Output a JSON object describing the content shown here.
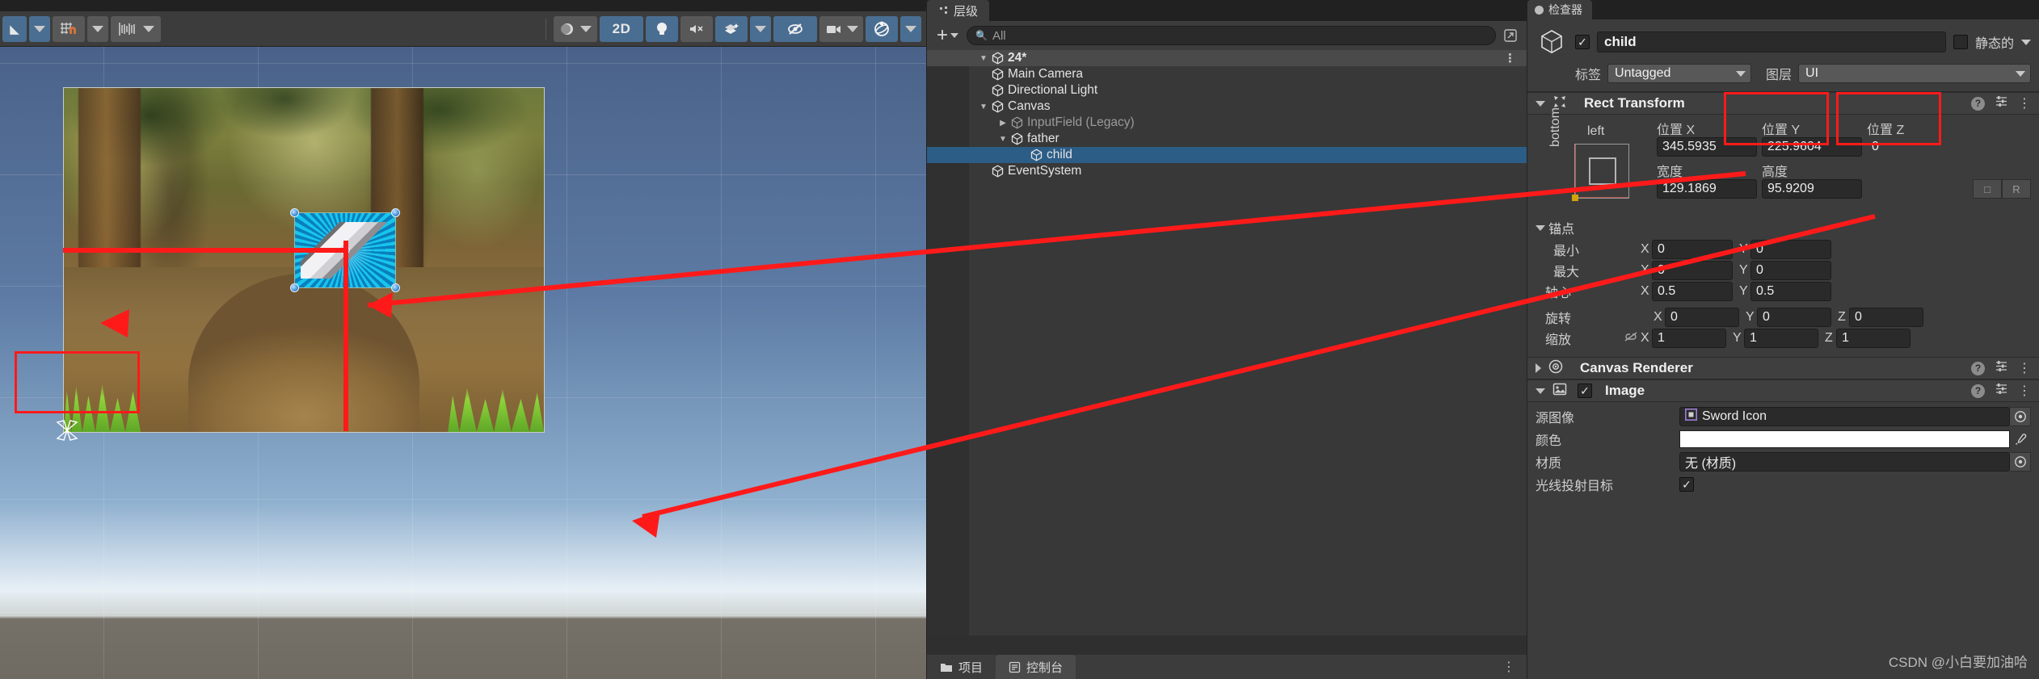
{
  "scene": {
    "toolbar": {
      "items": [
        {
          "name": "tool-handles-caret",
          "icon": "chevron-down-icon",
          "style": "blue"
        },
        {
          "name": "grid-snap-toggle",
          "icon": "grid-magnet-icon",
          "style": "gray"
        },
        {
          "name": "grid-snap-caret",
          "icon": "chevron-down-icon",
          "style": "gray"
        },
        {
          "name": "grid-visibility",
          "icon": "grid-lines-icon",
          "style": "gray"
        },
        {
          "name": "grid-visibility-caret",
          "icon": "chevron-down-icon",
          "style": "gray"
        }
      ],
      "draw_mode_label": "",
      "two_d_label": "2D",
      "lighting_icon": "lightbulb-icon",
      "audio_icon": "audio-mute-icon",
      "fx_icon": "effects-icon",
      "hidden_icon": "eye-slash-icon",
      "camera_icon": "camera-icon",
      "gizmos_icon": "gizmos-globe-icon"
    },
    "selection": {
      "object_name": "child",
      "sprite": "Sword Icon"
    }
  },
  "hierarchy": {
    "tab_label": "层级",
    "add_label": "+",
    "search_placeholder": "All",
    "search_value": "",
    "scene_name": "24*",
    "items": [
      {
        "label": "Main Camera",
        "depth": 1,
        "foldout": "none",
        "selected": false,
        "dim": false
      },
      {
        "label": "Directional Light",
        "depth": 1,
        "foldout": "none",
        "selected": false,
        "dim": false
      },
      {
        "label": "Canvas",
        "depth": 1,
        "foldout": "open",
        "selected": false,
        "dim": false
      },
      {
        "label": "InputField (Legacy)",
        "depth": 2,
        "foldout": "closed",
        "selected": false,
        "dim": true
      },
      {
        "label": "father",
        "depth": 2,
        "foldout": "open",
        "selected": false,
        "dim": false
      },
      {
        "label": "child",
        "depth": 3,
        "foldout": "none",
        "selected": true,
        "dim": false
      },
      {
        "label": "EventSystem",
        "depth": 1,
        "foldout": "none",
        "selected": false,
        "dim": false
      }
    ],
    "bottom_tabs": [
      {
        "label": "项目",
        "icon": "folder-icon",
        "active": false
      },
      {
        "label": "控制台",
        "icon": "console-icon",
        "active": true
      }
    ]
  },
  "inspector": {
    "tab_label": "检查器",
    "object": {
      "enabled": true,
      "name": "child",
      "static_label": "静态的",
      "static_checked": false,
      "tag_label": "标签",
      "tag_value": "Untagged",
      "layer_label": "图层",
      "layer_value": "UI"
    },
    "rect_transform": {
      "title": "Rect Transform",
      "anchor_preset_h": "left",
      "anchor_preset_v": "bottom",
      "pos_x_label": "位置 X",
      "pos_y_label": "位置 Y",
      "pos_z_label": "位置 Z",
      "pos_x": "345.5935",
      "pos_y": "225.9604",
      "pos_z": "0",
      "width_label": "宽度",
      "height_label": "高度",
      "width": "129.1869",
      "height": "95.9209",
      "blueprint_label": "",
      "raw_label": "R",
      "anchors_label": "锚点",
      "min_label": "最小",
      "max_label": "最大",
      "pivot_label": "轴心",
      "min_x": "0",
      "min_y": "0",
      "max_x": "0",
      "max_y": "0",
      "pivot_x": "0.5",
      "pivot_y": "0.5",
      "rotation_label": "旋转",
      "rot_x": "0",
      "rot_y": "0",
      "rot_z": "0",
      "scale_label": "缩放",
      "scale_x": "1",
      "scale_y": "1",
      "scale_z": "1",
      "axis_x": "X",
      "axis_y": "Y",
      "axis_z": "Z"
    },
    "canvas_renderer": {
      "title": "Canvas Renderer"
    },
    "image": {
      "title": "Image",
      "enabled": true,
      "source_label": "源图像",
      "source_value": "Sword Icon",
      "color_label": "颜色",
      "color_value": "#FFFFFF",
      "material_label": "材质",
      "material_value": "无 (材质)",
      "raycast_label": "光线投射目标",
      "raycast_checked": true
    }
  },
  "watermark": "CSDN @小白要加油哈"
}
